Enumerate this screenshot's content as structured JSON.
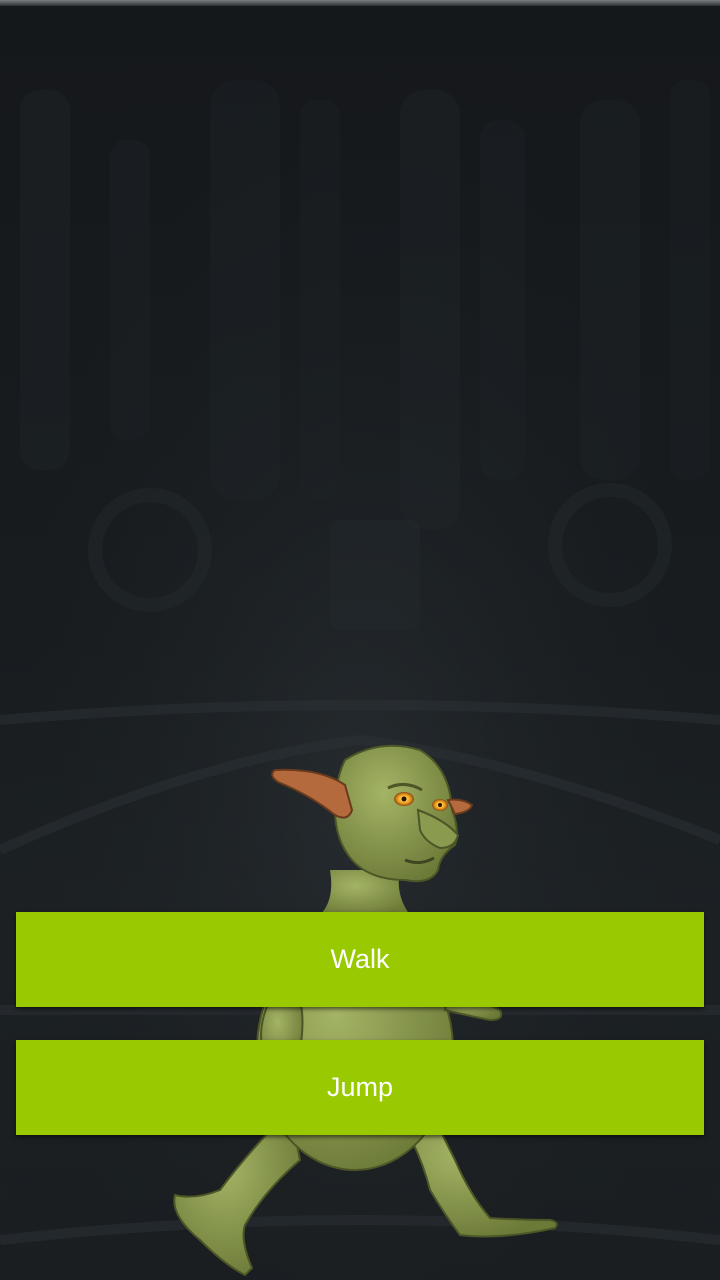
{
  "buttons": {
    "walk_label": "Walk",
    "jump_label": "Jump"
  },
  "colors": {
    "button_bg": "#99c900",
    "button_text": "#ffffff",
    "background": "#15181b",
    "goblin_skin": "#8a9a4e"
  },
  "scene": {
    "character": "goblin",
    "background": "dark-cave-corridor"
  }
}
